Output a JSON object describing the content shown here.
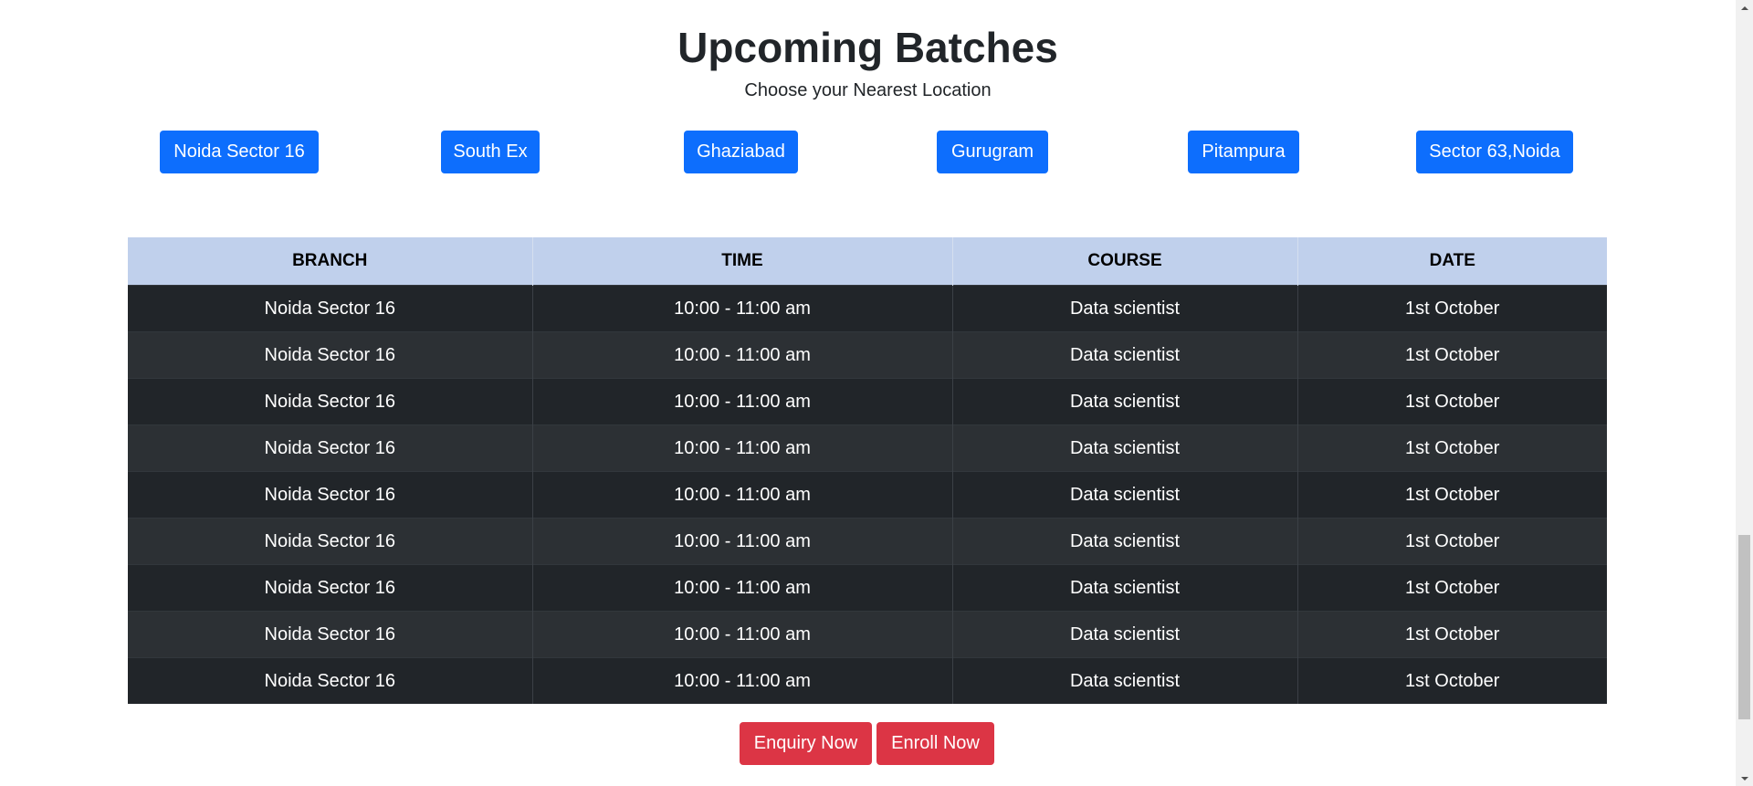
{
  "heading": {
    "title": "Upcoming Batches",
    "subtitle": "Choose your Nearest Location"
  },
  "locations": [
    "Noida Sector 16",
    "South Ex",
    "Ghaziabad",
    "Gurugram",
    "Pitampura",
    "Sector 63,Noida"
  ],
  "table": {
    "headers": [
      "BRANCH",
      "TIME",
      "COURSE",
      "DATE"
    ],
    "rows": [
      [
        "Noida Sector 16",
        "10:00 - 11:00 am",
        "Data scientist",
        "1st October"
      ],
      [
        "Noida Sector 16",
        "10:00 - 11:00 am",
        "Data scientist",
        "1st October"
      ],
      [
        "Noida Sector 16",
        "10:00 - 11:00 am",
        "Data scientist",
        "1st October"
      ],
      [
        "Noida Sector 16",
        "10:00 - 11:00 am",
        "Data scientist",
        "1st October"
      ],
      [
        "Noida Sector 16",
        "10:00 - 11:00 am",
        "Data scientist",
        "1st October"
      ],
      [
        "Noida Sector 16",
        "10:00 - 11:00 am",
        "Data scientist",
        "1st October"
      ],
      [
        "Noida Sector 16",
        "10:00 - 11:00 am",
        "Data scientist",
        "1st October"
      ],
      [
        "Noida Sector 16",
        "10:00 - 11:00 am",
        "Data scientist",
        "1st October"
      ],
      [
        "Noida Sector 16",
        "10:00 - 11:00 am",
        "Data scientist",
        "1st October"
      ]
    ]
  },
  "actions": {
    "enquiry_label": "Enquiry Now",
    "enroll_label": "Enroll Now"
  },
  "colors": {
    "primary": "#0d6efd",
    "danger": "#dc3545",
    "table_header": "#c0d0ec",
    "table_dark": "#212529"
  }
}
